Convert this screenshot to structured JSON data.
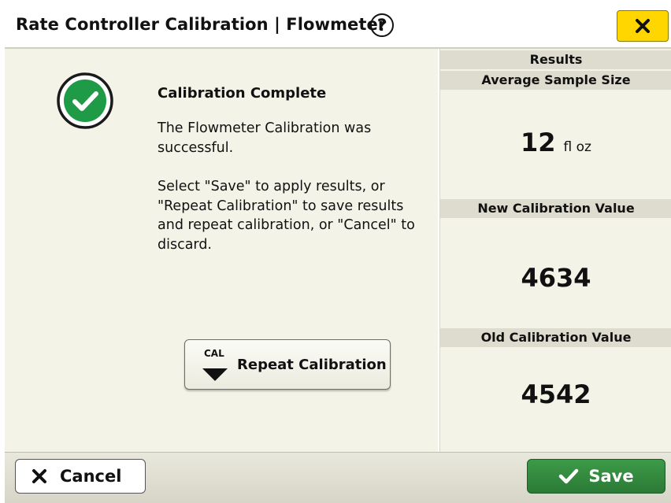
{
  "header": {
    "title": "Rate Controller Calibration | Flowmeter",
    "help_glyph": "?",
    "help_icon": "question-circle-icon",
    "close_icon": "close-x-icon"
  },
  "message": {
    "icon": "check-circle-icon",
    "title": "Calibration Complete",
    "line1": "The Flowmeter Calibration was successful.",
    "line2": "Select \"Save\" to apply results, or \"Repeat Calibration\" to save results and repeat calibration, or \"Cancel\" to discard."
  },
  "repeat_button": {
    "icon_text": "CAL",
    "label": "Repeat Calibration"
  },
  "results": {
    "title": "Results",
    "average_sample_size": {
      "label": "Average Sample Size",
      "value": "12",
      "unit": "fl oz"
    },
    "new_calibration": {
      "label": "New Calibration Value",
      "value": "4634"
    },
    "old_calibration": {
      "label": "Old Calibration Value",
      "value": "4542"
    }
  },
  "footer": {
    "cancel_label": "Cancel",
    "save_label": "Save"
  },
  "colors": {
    "close_button": "#ffd600",
    "save_button": "#2e8b3a",
    "success": "#1e9e46",
    "panel_bg": "#f4f3e8"
  }
}
